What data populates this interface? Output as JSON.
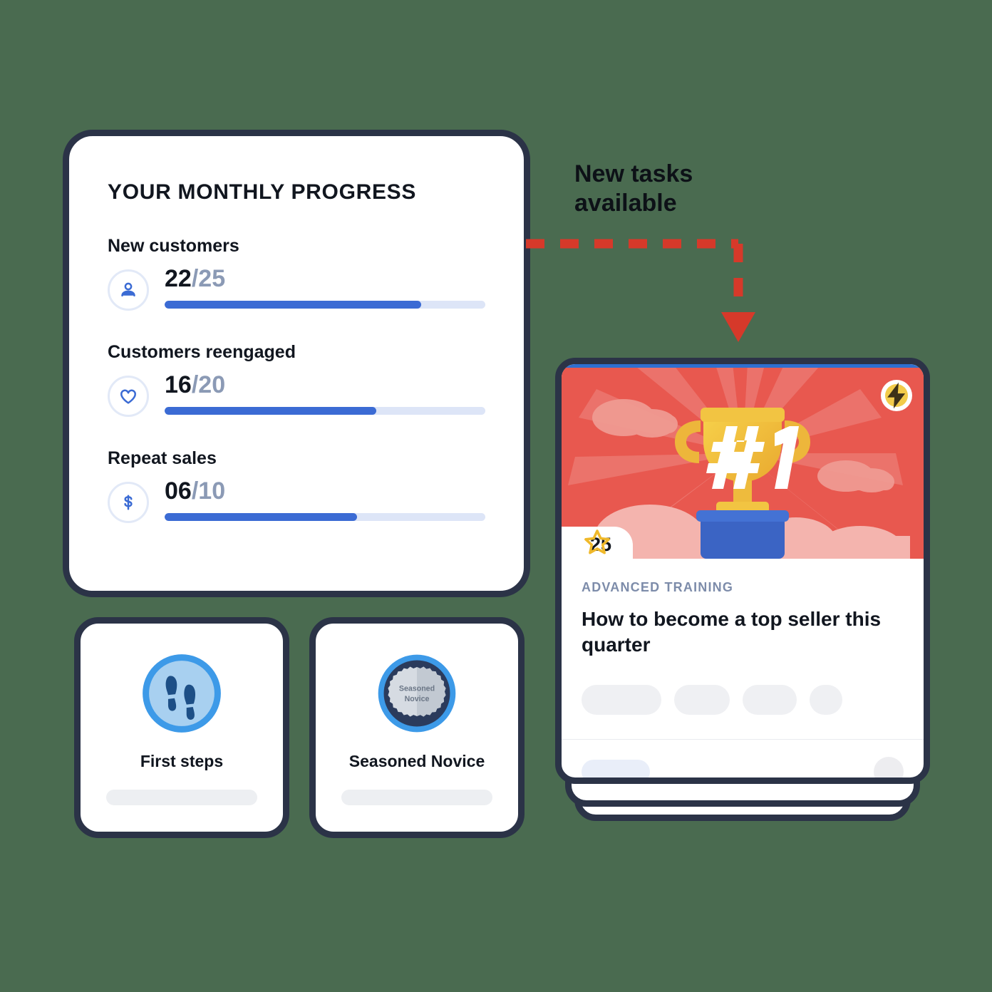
{
  "theme": {
    "background": "#4a6b50",
    "card_border": "#2b3347",
    "accent_blue": "#3b6bd4",
    "accent_red": "#e8584f",
    "arrow_red": "#d6392a",
    "muted_text": "#8b9ab5",
    "gold": "#f2cb4a"
  },
  "progress_card": {
    "title": "YOUR MONTHLY PROGRESS",
    "metrics": [
      {
        "label": "New customers",
        "icon": "person-icon",
        "current": "22",
        "separator": "/",
        "total": "25",
        "percent": 80
      },
      {
        "label": "Customers reengaged",
        "icon": "heart-icon",
        "current": "16",
        "separator": "/",
        "total": "20",
        "percent": 66
      },
      {
        "label": "Repeat sales",
        "icon": "dollar-icon",
        "current": "06",
        "separator": "/",
        "total": "10",
        "percent": 60
      }
    ]
  },
  "badges": [
    {
      "name": "First steps",
      "emblem": "footprints-badge-icon"
    },
    {
      "name": "Seasoned Novice",
      "emblem": "seasoned-novice-medal-icon",
      "medal_line1": "Seasoned",
      "medal_line2": "Novice"
    }
  ],
  "annotation": {
    "text": "New tasks\navailable",
    "arrow": "dashed-elbow-arrow-down"
  },
  "task_card": {
    "hero": {
      "trophy_label": "#1",
      "bolt_icon": "lightning-bolt-icon"
    },
    "rating": {
      "icon": "star-outline-icon",
      "value": "25"
    },
    "eyebrow": "ADVANCED TRAINING",
    "title": "How to become a top seller this quarter"
  }
}
